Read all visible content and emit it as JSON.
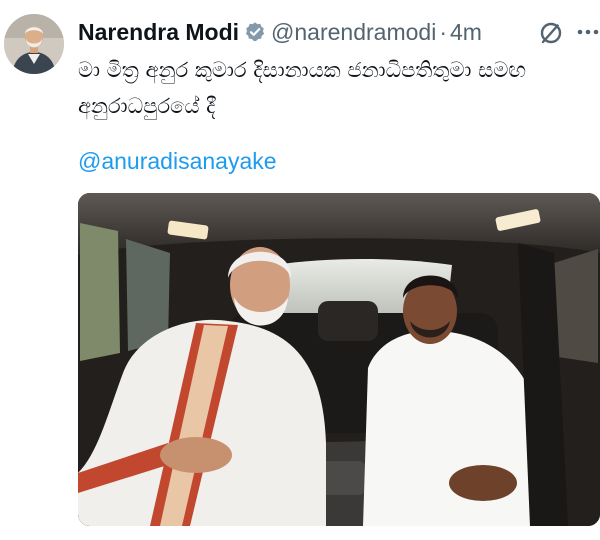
{
  "tweet": {
    "author": {
      "display_name": "Narendra Modi",
      "handle": "@narendramodi",
      "verified": true,
      "avatar_icon": "profile-avatar"
    },
    "separator": "·",
    "timestamp": "4m",
    "text": "මා මිත්‍ර අනුර කුමාර දිසානායක ජනාධිපතිතුමා සමඟ අනුරාධපුරයේ දී",
    "mention": "@anuradisanayake",
    "media": {
      "type": "photo",
      "scene": "two-men-seated-in-car"
    },
    "icons": {
      "verified": "verified-badge-icon",
      "grok": "grok-icon",
      "more": "more-options-icon"
    },
    "colors": {
      "link": "#1d9bf0",
      "secondary_text": "#536471",
      "primary_text": "#0f1419",
      "verified_badge": "#829aab"
    }
  }
}
